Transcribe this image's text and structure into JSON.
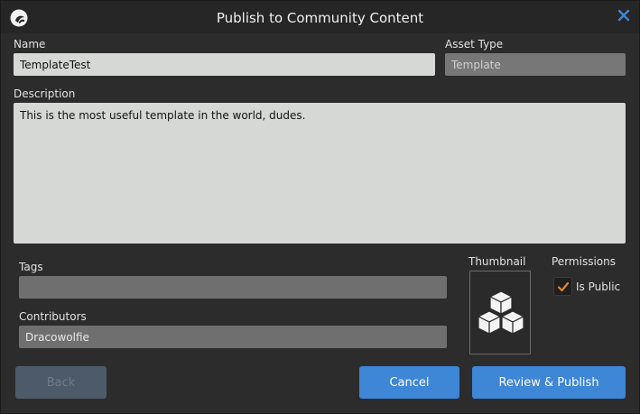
{
  "window": {
    "title": "Publish to Community Content"
  },
  "form": {
    "name_label": "Name",
    "name_value": "TemplateTest",
    "asset_type_label": "Asset Type",
    "asset_type_value": "Template",
    "description_label": "Description",
    "description_value": "This is the most useful template in the world, dudes.",
    "tags_label": "Tags",
    "tags_value": "",
    "contributors_label": "Contributors",
    "contributors_value": "Dracowolfie",
    "thumbnail_label": "Thumbnail",
    "permissions_label": "Permissions",
    "is_public_label": "Is Public",
    "is_public_checked": true
  },
  "buttons": {
    "back": "Back",
    "cancel": "Cancel",
    "review_publish": "Review & Publish"
  },
  "icons": {
    "logo": "app-logo-icon",
    "close": "close-icon",
    "thumbnail": "cubes-icon",
    "checkmark": "checkmark-icon"
  },
  "colors": {
    "accent": "#3e86d6",
    "close_icon": "#3e86d6",
    "check": "#e0852d",
    "disabled_button": "#4d5a69"
  }
}
